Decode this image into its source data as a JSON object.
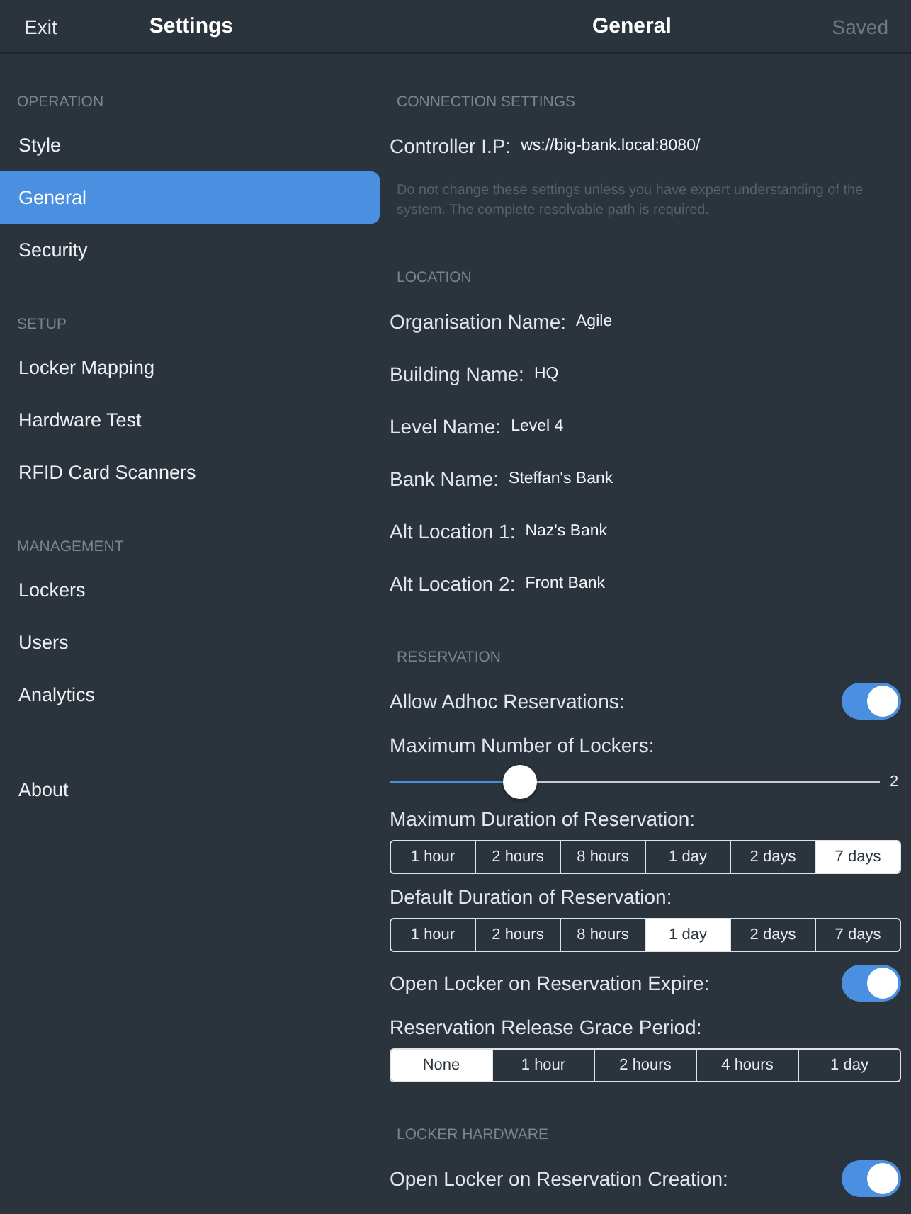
{
  "nav_bar": {
    "exit_button": "Exit",
    "sidebar_title": "Settings",
    "page_title": "General",
    "saved_button": "Saved",
    "saved_disabled": true
  },
  "sidebar": {
    "sections": [
      {
        "header": "OPERATION",
        "items": [
          {
            "label": "Style",
            "selected": false
          },
          {
            "label": "General",
            "selected": true
          },
          {
            "label": "Security",
            "selected": false
          }
        ]
      },
      {
        "header": "SETUP",
        "items": [
          {
            "label": "Locker Mapping",
            "selected": false
          },
          {
            "label": "Hardware Test",
            "selected": false
          },
          {
            "label": "RFID Card Scanners",
            "selected": false
          }
        ]
      },
      {
        "header": "MANAGEMENT",
        "items": [
          {
            "label": "Lockers",
            "selected": false
          },
          {
            "label": "Users",
            "selected": false
          },
          {
            "label": "Analytics",
            "selected": false
          }
        ]
      },
      {
        "items": [
          {
            "label": "About",
            "selected": false
          }
        ]
      }
    ]
  },
  "main": {
    "sections": [
      {
        "header": "CONNECTION SETTINGS",
        "rows": [
          {
            "kind": "field",
            "label": "Controller I.P:",
            "value": "ws://big-bank.local:8080/"
          },
          {
            "kind": "note",
            "text": "Do not change these settings unless you have expert understanding of the system. The complete resolvable path is required."
          }
        ]
      },
      {
        "header": "LOCATION",
        "rows": [
          {
            "kind": "field",
            "label": "Organisation Name:",
            "value": "Agile"
          },
          {
            "kind": "field",
            "label": "Building Name:",
            "value": "HQ"
          },
          {
            "kind": "field",
            "label": "Level Name:",
            "value": "Level 4"
          },
          {
            "kind": "field",
            "label": "Bank Name:",
            "value": "Steffan's Bank"
          },
          {
            "kind": "field",
            "label": "Alt Location 1:",
            "value": "Naz's Bank"
          },
          {
            "kind": "field",
            "label": "Alt Location 2:",
            "value": "Front Bank"
          }
        ]
      },
      {
        "header": "RESERVATION",
        "rows": [
          {
            "kind": "toggle",
            "label": "Allow Adhoc Reservations:",
            "on": true
          },
          {
            "kind": "label",
            "text": "Maximum Number of Lockers:"
          },
          {
            "kind": "slider",
            "level": 0.265,
            "reading": "2"
          },
          {
            "kind": "label",
            "text": "Maximum Duration of Reservation:"
          },
          {
            "kind": "segmented",
            "options": [
              {
                "label": "1 hour",
                "selected": false
              },
              {
                "label": "2 hours",
                "selected": false
              },
              {
                "label": "8 hours",
                "selected": false
              },
              {
                "label": "1 day",
                "selected": false
              },
              {
                "label": "2 days",
                "selected": false
              },
              {
                "label": "7 days",
                "selected": true
              }
            ]
          },
          {
            "kind": "label",
            "text": "Default Duration of Reservation:"
          },
          {
            "kind": "segmented",
            "options": [
              {
                "label": "1 hour",
                "selected": false
              },
              {
                "label": "2 hours",
                "selected": false
              },
              {
                "label": "8 hours",
                "selected": false
              },
              {
                "label": "1 day",
                "selected": true
              },
              {
                "label": "2 days",
                "selected": false
              },
              {
                "label": "7 days",
                "selected": false
              }
            ]
          },
          {
            "kind": "toggle",
            "label": "Open Locker on Reservation Expire:",
            "on": true
          },
          {
            "kind": "label",
            "text": "Reservation Release Grace Period:"
          },
          {
            "kind": "segmented",
            "options": [
              {
                "label": "None",
                "selected": true
              },
              {
                "label": "1 hour",
                "selected": false
              },
              {
                "label": "2 hours",
                "selected": false
              },
              {
                "label": "4 hours",
                "selected": false
              },
              {
                "label": "1 day",
                "selected": false
              }
            ]
          }
        ]
      },
      {
        "header": "LOCKER HARDWARE",
        "rows": [
          {
            "kind": "toggle",
            "label": "Open Locker on Reservation Creation:",
            "on": true
          }
        ]
      }
    ]
  }
}
